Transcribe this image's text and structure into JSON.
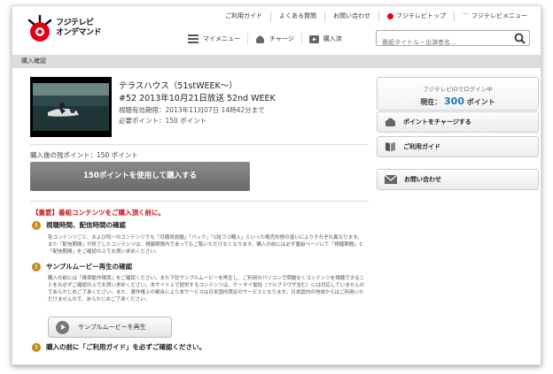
{
  "brand": {
    "logo_line1": "フジテレビ",
    "logo_line2": "オンデマンド"
  },
  "topnav": [
    "ご利用ガイド",
    "よくある質問",
    "お問い合わせ",
    "フジテレビトップ",
    "フジテレビメニュー"
  ],
  "subnav": {
    "mymenu": "マイメニュー",
    "charge": "チャージ",
    "purchased": "購入済"
  },
  "search": {
    "placeholder": "番組タイトル・出演者名..."
  },
  "breadcrumb": "購入確認",
  "product": {
    "title": "テラスハウス（51stWEEK〜）",
    "episode": "#52 2013年10月21日放送 52nd WEEK",
    "expiry": "視聴有効期限：2013年11月07日 14時42分まで",
    "required_points": "必要ポイント：150 ポイント"
  },
  "remaining": "購入後の残ポイント：150 ポイント",
  "buy_button": "150ポイントを使用して購入する",
  "important": "【重要】番組コンテンツをご購入頂く前に。",
  "section1": {
    "heading": "視聴時間、配信時間の確認",
    "text": "各コンテンツごと、および同一のコンテンツでも「月額見放題」「パック」「1話づつ購入」といった販売形態の違いによりそれぞれ異なります。また「配信期間」が終了したコンテンツは、視聴期限内であってもご覧いただけなくなります。購入の前には必ず番組ページにて「視聴期間」と「配信期間」をご確認の上でお買い求めください。"
  },
  "section2": {
    "heading": "サンプルムービー再生の確認",
    "text": "購入の前には「推奨動作環境」をご確認ください。また下記サンプルムービーを再生し、ご利用のパソコンで問題なくコンテンツを視聴できることをお必ずご確認の上でお買い求めください。本サイト上で提供するコンテンツは、ケータイ電話（フルブラウザ含む）には対応していませんのであらかじめご了承ください。また、著作権上の都合により本サービスは日本国内限定のサービスとなります。日本国内の地域からはご利用いただけませんので、あらかじめご了承ください。"
  },
  "sample_button": "サンプルムービーを再生",
  "section3": {
    "heading": "購入の前に「ご利用ガイド」を必ずご確認ください。"
  },
  "sidebar": {
    "login_status": "フジテレビIDでログイン中",
    "current_label": "現在：",
    "current_points": "300",
    "points_unit": "ポイント",
    "charge_button": "ポイントをチャージする",
    "guide_button": "ご利用ガイド",
    "contact_button": "お問い合わせ"
  },
  "colors": {
    "accent_red": "#e60012",
    "points_blue": "#1a73c8",
    "warning": "#c48a1d"
  }
}
